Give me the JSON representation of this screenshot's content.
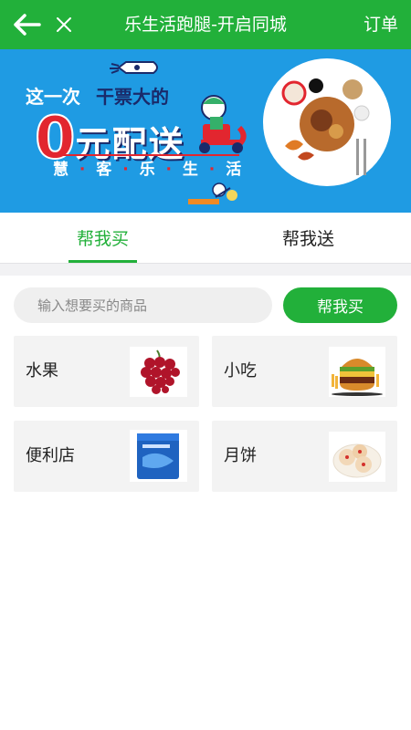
{
  "header": {
    "title": "乐生活跑腿-开启同城",
    "orders_label": "订单",
    "back_icon": "arrow-left-icon",
    "close_icon": "close-icon"
  },
  "banner": {
    "line1_a": "这一次",
    "line1_b": "干票大的",
    "zero": "0",
    "yuan": "元配送",
    "sub": [
      "慧",
      "客",
      "乐",
      "生",
      "活"
    ]
  },
  "tabs": [
    {
      "label": "帮我买",
      "active": true
    },
    {
      "label": "帮我送",
      "active": false
    }
  ],
  "search": {
    "placeholder": "输入想要买的商品",
    "button_label": "帮我买"
  },
  "categories": [
    {
      "label": "水果",
      "icon": "grapes-image"
    },
    {
      "label": "小吃",
      "icon": "burger-image"
    },
    {
      "label": "便利店",
      "icon": "store-product-image"
    },
    {
      "label": "月饼",
      "icon": "mooncake-image"
    }
  ],
  "colors": {
    "brand": "#22b03a",
    "banner": "#1f9be3",
    "accent": "#e2262f"
  }
}
